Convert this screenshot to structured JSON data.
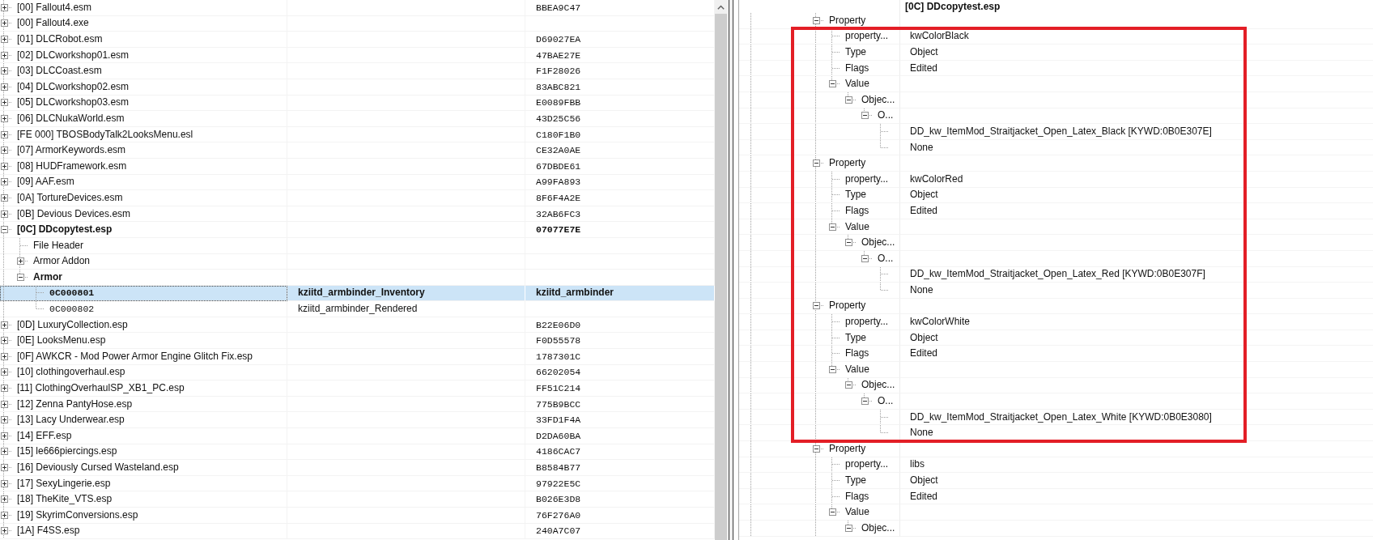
{
  "plugin_tree": {
    "nodes": [
      {
        "kind": "group",
        "label": "[00] Fallout4.esm",
        "column_3": "BBEA9C47",
        "expanded": false,
        "selected": false,
        "edited": false
      },
      {
        "kind": "group",
        "label": "[00] Fallout4.exe",
        "expanded": false,
        "selected": false,
        "edited": false
      },
      {
        "kind": "group",
        "label": "[01] DLCRobot.esm",
        "column_3": "D69027EA",
        "expanded": false,
        "selected": false,
        "edited": false
      },
      {
        "kind": "group",
        "label": "[02] DLCworkshop01.esm",
        "column_3": "47BAE27E",
        "expanded": false,
        "selected": false,
        "edited": false
      },
      {
        "kind": "group",
        "label": "[03] DLCCoast.esm",
        "column_3": "F1F28026",
        "expanded": false,
        "selected": false,
        "edited": false
      },
      {
        "kind": "group",
        "label": "[04] DLCworkshop02.esm",
        "column_3": "83ABC821",
        "expanded": false,
        "selected": false,
        "edited": false
      },
      {
        "kind": "group",
        "label": "[05] DLCworkshop03.esm",
        "column_3": "E0089FBB",
        "expanded": false,
        "selected": false,
        "edited": false
      },
      {
        "kind": "group",
        "label": "[06] DLCNukaWorld.esm",
        "column_3": "43D25C56",
        "expanded": false,
        "selected": false,
        "edited": false
      },
      {
        "kind": "group",
        "label": "[FE 000] TBOSBodyTalk2LooksMenu.esl",
        "column_3": "C180F1B0",
        "expanded": false,
        "selected": false,
        "edited": false
      },
      {
        "kind": "group",
        "label": "[07] ArmorKeywords.esm",
        "column_3": "CE32A0AE",
        "expanded": false,
        "selected": false,
        "edited": false
      },
      {
        "kind": "group",
        "label": "[08] HUDFramework.esm",
        "column_3": "67DBDE61",
        "expanded": false,
        "selected": false,
        "edited": false
      },
      {
        "kind": "group",
        "label": "[09] AAF.esm",
        "column_3": "A99FA893",
        "expanded": false,
        "selected": false,
        "edited": false
      },
      {
        "kind": "group",
        "label": "[0A] TortureDevices.esm",
        "column_3": "8F6F4A2E",
        "expanded": false,
        "selected": false,
        "edited": false
      },
      {
        "kind": "group",
        "label": "[0B] Devious Devices.esm",
        "column_3": "32AB6FC3",
        "expanded": false,
        "selected": false,
        "edited": false
      },
      {
        "kind": "group",
        "label": "[0C] DDcopytest.esp",
        "column_3": "07077E7E",
        "expanded": true,
        "selected": false,
        "edited": true,
        "children": [
          {
            "kind": "item",
            "label": "File Header",
            "selected": false,
            "edited": false
          },
          {
            "kind": "group",
            "label": "Armor Addon",
            "expanded": false,
            "selected": false,
            "edited": false
          },
          {
            "kind": "group",
            "label": "Armor",
            "expanded": true,
            "selected": false,
            "edited": true,
            "children": [
              {
                "kind": "record",
                "label": "0C000801",
                "column_2": "kziitd_armbinder_Inventory",
                "column_3": "kziitd_armbinder",
                "selected": true,
                "edited": true
              },
              {
                "kind": "record",
                "label": "0C000802",
                "column_2": "kziitd_armbinder_Rendered",
                "selected": false,
                "edited": false
              }
            ]
          }
        ]
      },
      {
        "kind": "group",
        "label": "[0D] LuxuryCollection.esp",
        "column_3": "B22E06D0",
        "expanded": false,
        "selected": false,
        "edited": false
      },
      {
        "kind": "group",
        "label": "[0E] LooksMenu.esp",
        "column_3": "F0D55578",
        "expanded": false,
        "selected": false,
        "edited": false
      },
      {
        "kind": "group",
        "label": "[0F] AWKCR - Mod Power Armor Engine Glitch Fix.esp",
        "column_3": "1787301C",
        "expanded": false,
        "selected": false,
        "edited": false
      },
      {
        "kind": "group",
        "label": "[10] clothingoverhaul.esp",
        "column_3": "66202054",
        "expanded": false,
        "selected": false,
        "edited": false
      },
      {
        "kind": "group",
        "label": "[11] ClothingOverhaulSP_XB1_PC.esp",
        "column_3": "FF51C214",
        "expanded": false,
        "selected": false,
        "edited": false
      },
      {
        "kind": "group",
        "label": "[12] Zenna PantyHose.esp",
        "column_3": "775B9BCC",
        "expanded": false,
        "selected": false,
        "edited": false
      },
      {
        "kind": "group",
        "label": "[13] Lacy Underwear.esp",
        "column_3": "33FD1F4A",
        "expanded": false,
        "selected": false,
        "edited": false
      },
      {
        "kind": "group",
        "label": "[14] EFF.esp",
        "column_3": "D2DA60BA",
        "expanded": false,
        "selected": false,
        "edited": false
      },
      {
        "kind": "group",
        "label": "[15] le666piercings.esp",
        "column_3": "4186CAC7",
        "expanded": false,
        "selected": false,
        "edited": false
      },
      {
        "kind": "group",
        "label": "[16] Deviously Cursed Wasteland.esp",
        "column_3": "B8584B77",
        "expanded": false,
        "selected": false,
        "edited": false
      },
      {
        "kind": "group",
        "label": "[17] SexyLingerie.esp",
        "column_3": "97922E5C",
        "expanded": false,
        "selected": false,
        "edited": false
      },
      {
        "kind": "group",
        "label": "[18] TheKite_VTS.esp",
        "column_3": "B026E3D8",
        "expanded": false,
        "selected": false,
        "edited": false
      },
      {
        "kind": "group",
        "label": "[19] SkyrimConversions.esp",
        "column_3": "76F276A0",
        "expanded": false,
        "selected": false,
        "edited": false
      },
      {
        "kind": "group",
        "label": "[1A] F4SS.esp",
        "column_3": "240A7C07",
        "expanded": false,
        "selected": false,
        "edited": false
      }
    ]
  },
  "record_view": {
    "column_header": "[0C] DDcopytest.esp",
    "properties": [
      {
        "kind": "group",
        "label": "Property",
        "expanded": true,
        "highlighted": true,
        "children": [
          {
            "kind": "field",
            "label": "property...",
            "value": "kwColorBlack"
          },
          {
            "kind": "field",
            "label": "Type",
            "value": "Object"
          },
          {
            "kind": "field",
            "label": "Flags",
            "value": "Edited"
          },
          {
            "kind": "group",
            "label": "Value",
            "expanded": true,
            "children": [
              {
                "kind": "group",
                "label": "Objec...",
                "expanded": true,
                "children": [
                  {
                    "kind": "group",
                    "label": "O...",
                    "expanded": true,
                    "children": [
                      {
                        "kind": "field",
                        "value": "DD_kw_ItemMod_Straitjacket_Open_Latex_Black [KYWD:0B0E307E]"
                      },
                      {
                        "kind": "field",
                        "value": "None"
                      }
                    ]
                  }
                ]
              }
            ]
          }
        ]
      },
      {
        "kind": "group",
        "label": "Property",
        "expanded": true,
        "highlighted": true,
        "children": [
          {
            "kind": "field",
            "label": "property...",
            "value": "kwColorRed"
          },
          {
            "kind": "field",
            "label": "Type",
            "value": "Object"
          },
          {
            "kind": "field",
            "label": "Flags",
            "value": "Edited"
          },
          {
            "kind": "group",
            "label": "Value",
            "expanded": true,
            "children": [
              {
                "kind": "group",
                "label": "Objec...",
                "expanded": true,
                "children": [
                  {
                    "kind": "group",
                    "label": "O...",
                    "expanded": true,
                    "children": [
                      {
                        "kind": "field",
                        "value": "DD_kw_ItemMod_Straitjacket_Open_Latex_Red [KYWD:0B0E307F]"
                      },
                      {
                        "kind": "field",
                        "value": "None"
                      }
                    ]
                  }
                ]
              }
            ]
          }
        ]
      },
      {
        "kind": "group",
        "label": "Property",
        "expanded": true,
        "highlighted": true,
        "children": [
          {
            "kind": "field",
            "label": "property...",
            "value": "kwColorWhite"
          },
          {
            "kind": "field",
            "label": "Type",
            "value": "Object"
          },
          {
            "kind": "field",
            "label": "Flags",
            "value": "Edited"
          },
          {
            "kind": "group",
            "label": "Value",
            "expanded": true,
            "children": [
              {
                "kind": "group",
                "label": "Objec...",
                "expanded": true,
                "children": [
                  {
                    "kind": "group",
                    "label": "O...",
                    "expanded": true,
                    "children": [
                      {
                        "kind": "field",
                        "value": "DD_kw_ItemMod_Straitjacket_Open_Latex_White [KYWD:0B0E3080]"
                      },
                      {
                        "kind": "field",
                        "value": "None"
                      }
                    ]
                  }
                ]
              }
            ]
          }
        ]
      },
      {
        "kind": "group",
        "label": "Property",
        "expanded": true,
        "highlighted": false,
        "children": [
          {
            "kind": "field",
            "label": "property...",
            "value": "libs"
          },
          {
            "kind": "field",
            "label": "Type",
            "value": "Object"
          },
          {
            "kind": "field",
            "label": "Flags",
            "value": "Edited"
          },
          {
            "kind": "group",
            "label": "Value",
            "expanded": true,
            "children": [
              {
                "kind": "group",
                "label": "Objec...",
                "expanded": true
              }
            ]
          }
        ]
      }
    ]
  }
}
